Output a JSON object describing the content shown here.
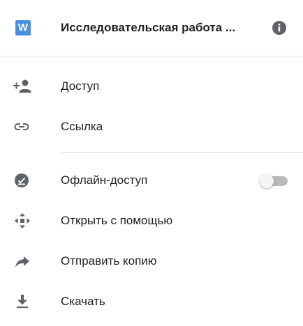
{
  "header": {
    "file_icon_letter": "W",
    "file_title": "Исследовательская работа ...",
    "file_icon_color": "#4a8fe2"
  },
  "menu": {
    "items": [
      {
        "label": "Доступ",
        "icon": "person-add-icon"
      },
      {
        "label": "Ссылка",
        "icon": "link-icon"
      },
      {
        "label": "Офлайн-доступ",
        "icon": "offline-check-icon",
        "toggle": false
      },
      {
        "label": "Открыть с помощью",
        "icon": "open-with-icon"
      },
      {
        "label": "Отправить копию",
        "icon": "share-arrow-icon"
      },
      {
        "label": "Скачать",
        "icon": "download-icon"
      }
    ]
  },
  "colors": {
    "icon": "#5f6368",
    "text": "#212121",
    "divider": "#dcdcdc"
  }
}
